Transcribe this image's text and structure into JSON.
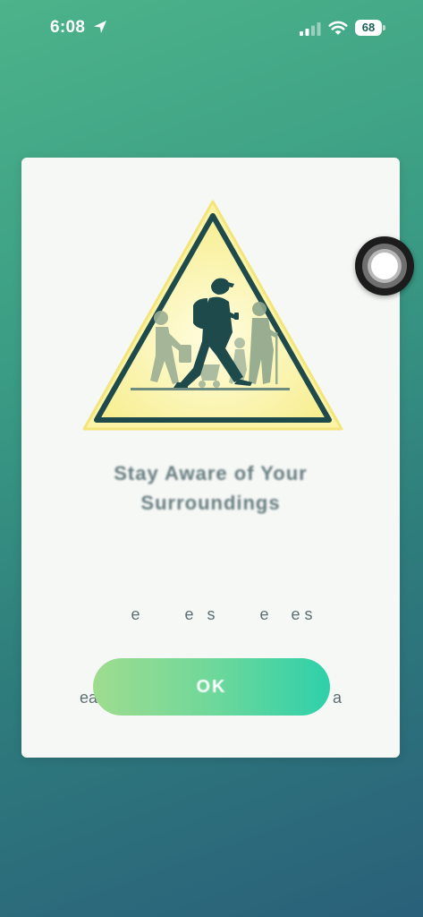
{
  "status_bar": {
    "time": "6:08",
    "battery_level": "68",
    "icons": [
      "location-arrow-icon",
      "cellular-signal-icon",
      "wifi-icon",
      "battery-icon"
    ]
  },
  "card": {
    "illustration": "pedestrian-crossing-warning-sign",
    "title_lines": [
      "Stay Aware of Your",
      "Surroundings"
    ],
    "description_lines": [
      "     e          e   s          e     e s",
      "ea                                es as            a"
    ],
    "button_label": "OK"
  },
  "assistive_touch": {
    "icon": "assistive-touch-icon"
  },
  "colors": {
    "background_top": "#4cb38a",
    "background_bottom": "#2a607a",
    "card": "#f6f8f6",
    "sign_fill": "#fbf3a0",
    "sign_border": "#1f4a4c",
    "button_start": "#9fdc8f",
    "button_end": "#2ed0aa",
    "title_text": "#687d80"
  }
}
